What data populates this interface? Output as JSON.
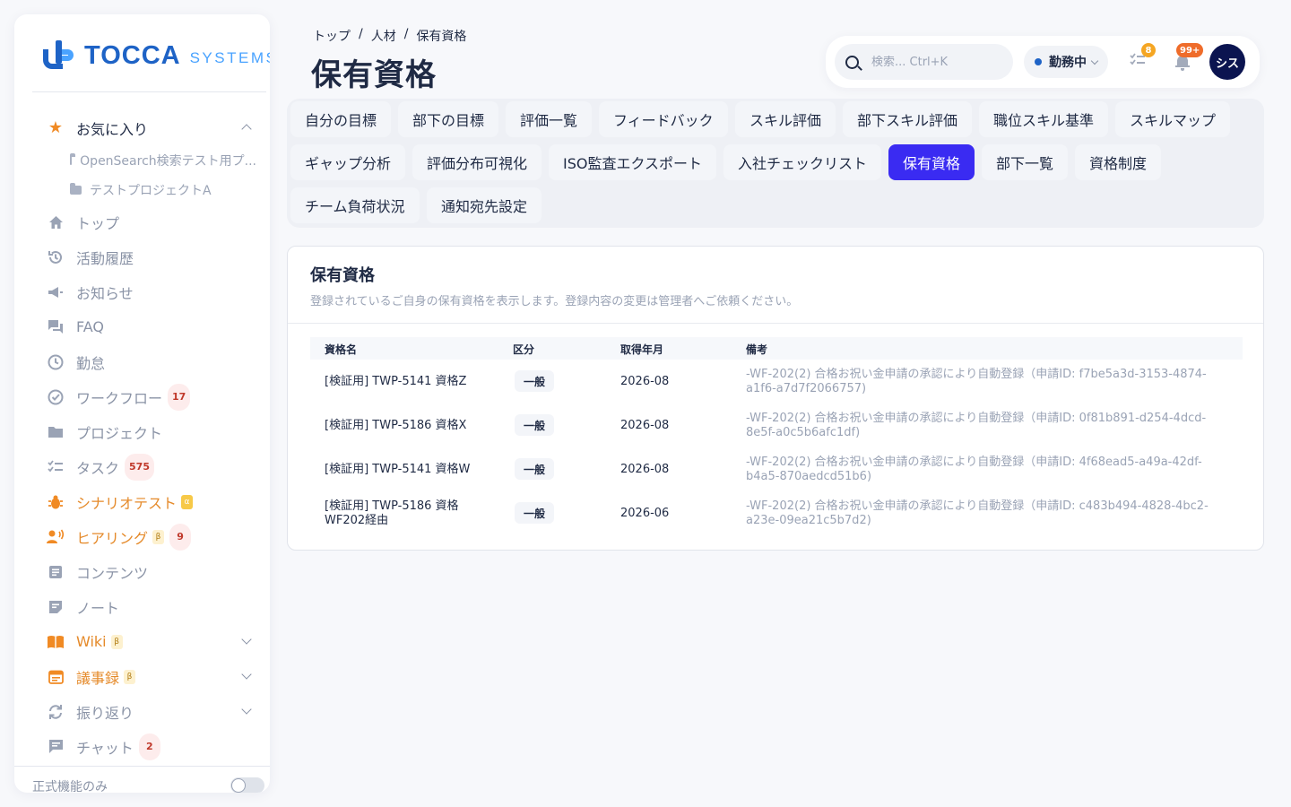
{
  "brand": {
    "name": "TOCCA",
    "suffix": "SYSTEMS"
  },
  "sidebar": {
    "favorites_label": "お気に入り",
    "favorites": [
      {
        "label": "OpenSearch検索テスト用プ..."
      },
      {
        "label": "テストプロジェクトA"
      }
    ],
    "items": [
      {
        "label": "トップ",
        "icon": "home-icon"
      },
      {
        "label": "活動履歴",
        "icon": "history-icon"
      },
      {
        "label": "お知らせ",
        "icon": "megaphone-icon"
      },
      {
        "label": "FAQ",
        "icon": "chat-icon"
      },
      {
        "label": "勤怠",
        "icon": "clock-icon"
      },
      {
        "label": "ワークフロー",
        "icon": "check-circle-icon",
        "badge": "17"
      },
      {
        "label": "プロジェクト",
        "icon": "folder-icon"
      },
      {
        "label": "タスク",
        "icon": "checklist-icon",
        "badge": "575"
      },
      {
        "label": "シナリオテスト",
        "icon": "bug-icon",
        "tag": "α"
      },
      {
        "label": "ヒアリング",
        "icon": "speaker-icon",
        "tag": "β",
        "badge": "9"
      },
      {
        "label": "コンテンツ",
        "icon": "document-icon"
      },
      {
        "label": "ノート",
        "icon": "note-icon"
      },
      {
        "label": "Wiki",
        "icon": "book-icon",
        "tag": "β"
      },
      {
        "label": "議事録",
        "icon": "calendar-icon",
        "tag": "β"
      },
      {
        "label": "振り返り",
        "icon": "refresh-icon"
      },
      {
        "label": "チャット",
        "icon": "message-icon",
        "badge": "2"
      }
    ],
    "footer_label": "正式機能のみ"
  },
  "header": {
    "breadcrumb": [
      "トップ",
      "/",
      "人材",
      "/",
      "保有資格"
    ],
    "title": "保有資格",
    "search_placeholder": "検索... Ctrl+K",
    "status": "勤務中",
    "task_badge": "8",
    "bell_badge": "99+",
    "avatar": "シス"
  },
  "tabs": [
    "自分の目標",
    "部下の目標",
    "評価一覧",
    "フィードバック",
    "スキル評価",
    "部下スキル評価",
    "職位スキル基準",
    "スキルマップ",
    "ギャップ分析",
    "評価分布可視化",
    "ISO監査エクスポート",
    "入社チェックリスト",
    "保有資格",
    "部下一覧",
    "資格制度",
    "チーム負荷状況",
    "通知宛先設定"
  ],
  "active_tab": "保有資格",
  "card": {
    "title": "保有資格",
    "description": "登録されているご自身の保有資格を表示します。登録内容の変更は管理者へご依頼ください。",
    "columns": [
      "資格名",
      "区分",
      "取得年月",
      "備考"
    ],
    "rows": [
      {
        "name": "[検証用] TWP-5141 資格Z",
        "category": "一般",
        "date": "2026-08",
        "note": "-WF-202(2) 合格お祝い金申請の承認により自動登録（申請ID: f7be5a3d-3153-4874-a1f6-a7d7f2066757)"
      },
      {
        "name": "[検証用] TWP-5186 資格X",
        "category": "一般",
        "date": "2026-08",
        "note": "-WF-202(2) 合格お祝い金申請の承認により自動登録（申請ID: 0f81b891-d254-4dcd-8e5f-a0c5b6afc1df)"
      },
      {
        "name": "[検証用] TWP-5141 資格W",
        "category": "一般",
        "date": "2026-08",
        "note": "-WF-202(2) 合格お祝い金申請の承認により自動登録（申請ID: 4f68ead5-a49a-42df-b4a5-870aedcd51b6)"
      },
      {
        "name": "[検証用] TWP-5186 資格 WF202経由",
        "category": "一般",
        "date": "2026-06",
        "note": "-WF-202(2) 合格お祝い金申請の承認により自動登録（申請ID: c483b494-4828-4bc2-a23e-09ea21c5b7d2)"
      }
    ]
  },
  "colors": {
    "accent": "#3a2bf2",
    "brand": "#1e63c6",
    "orange": "#e58a2a",
    "avatar_bg": "#0b1450"
  }
}
